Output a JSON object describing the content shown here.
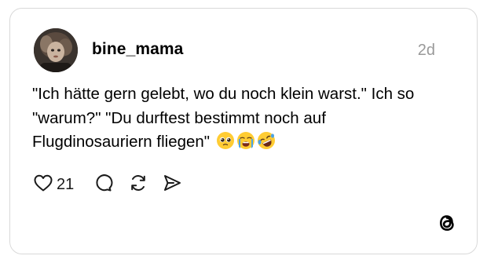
{
  "post": {
    "author": {
      "username": "bine_mama",
      "avatar_icon": "profile-photo-avatar"
    },
    "timestamp": "2d",
    "text": "\"Ich hätte gern gelebt, wo du noch klein warst.\" Ich so \"warum?\" \"Du durftest bestimmt noch auf Flugdinosauriern fliegen\"",
    "emojis": [
      "pleading-face-emoji",
      "loudly-crying-face-emoji",
      "rolling-on-floor-laughing-emoji"
    ],
    "actions": {
      "like_icon": "heart-icon",
      "like_count": "21",
      "reply_icon": "comment-bubble-icon",
      "repost_icon": "repost-icon",
      "share_icon": "send-icon"
    }
  },
  "brand": {
    "logo_icon": "threads-logo-icon"
  },
  "colors": {
    "border": "#d9d9d9",
    "timestamp": "#999999",
    "text": "#000000",
    "emoji_face": "#ffcc33"
  }
}
